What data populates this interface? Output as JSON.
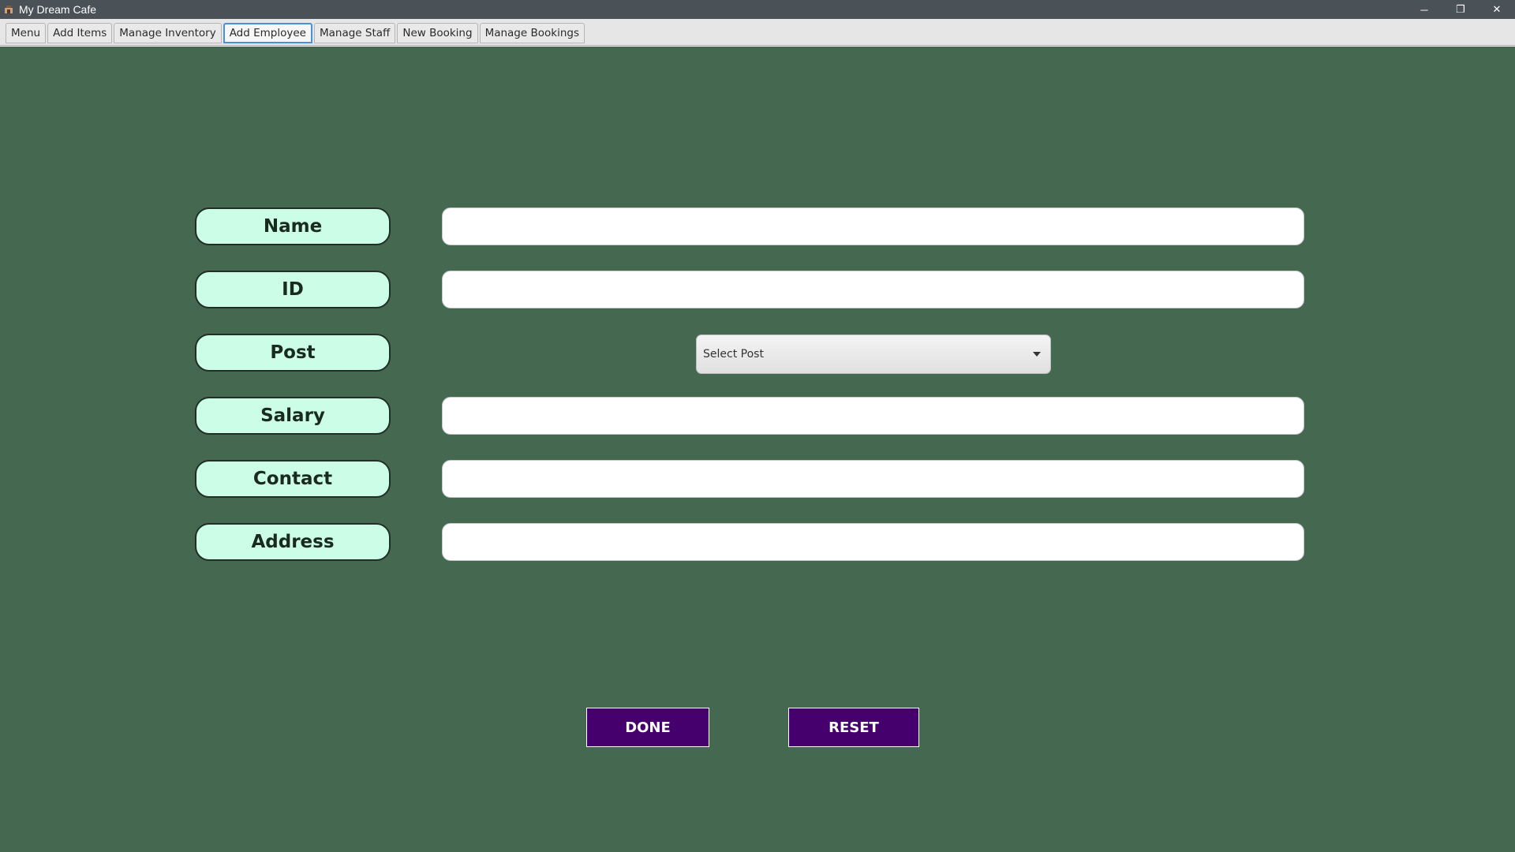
{
  "window": {
    "title": "My Dream Cafe",
    "controls": {
      "minimize": "─",
      "restore": "❐",
      "close": "✕"
    }
  },
  "tabs": [
    {
      "label": "Menu",
      "active": false
    },
    {
      "label": "Add Items",
      "active": false
    },
    {
      "label": "Manage Inventory",
      "active": false
    },
    {
      "label": "Add Employee",
      "active": true
    },
    {
      "label": "Manage Staff",
      "active": false
    },
    {
      "label": "New Booking",
      "active": false
    },
    {
      "label": "Manage Bookings",
      "active": false
    }
  ],
  "form": {
    "name_label": "Name",
    "name_value": "",
    "id_label": "ID",
    "id_value": "",
    "post_label": "Post",
    "post_select": "Select Post",
    "salary_label": "Salary",
    "salary_value": "",
    "contact_label": "Contact",
    "contact_value": "",
    "address_label": "Address",
    "address_value": ""
  },
  "buttons": {
    "done": "DONE",
    "reset": "RESET"
  },
  "colors": {
    "background": "#446950",
    "label_fill": "#ccfde6",
    "button_fill": "#46006e",
    "active_tab_border": "#4a90d9"
  }
}
